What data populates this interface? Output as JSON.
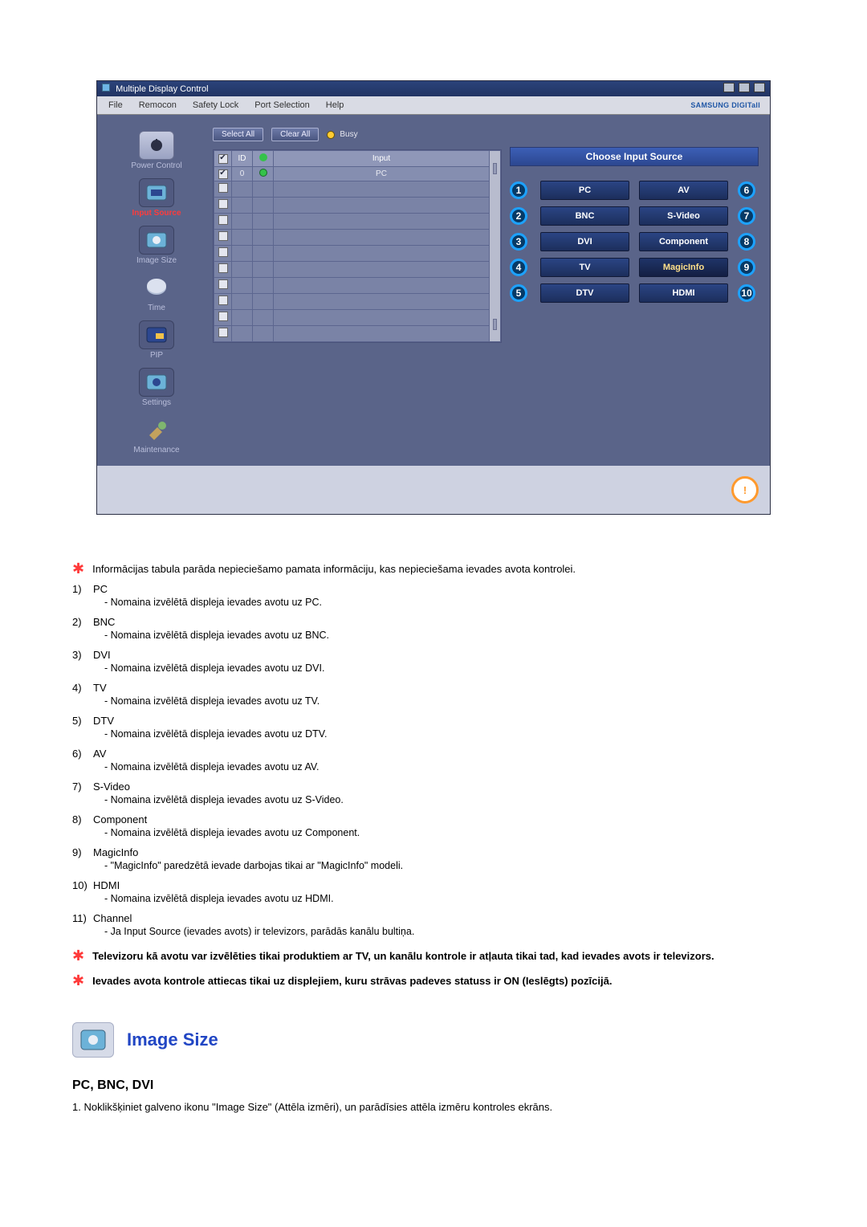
{
  "app": {
    "title": "Multiple Display Control",
    "brand": "SAMSUNG DIGITall",
    "menu": [
      "File",
      "Remocon",
      "Safety Lock",
      "Port Selection",
      "Help"
    ],
    "buttons": {
      "select_all": "Select All",
      "clear_all": "Clear All",
      "busy": "Busy"
    },
    "sidebar": {
      "items": [
        {
          "id": "power-control",
          "label": "Power Control"
        },
        {
          "id": "input-source",
          "label": "Input Source"
        },
        {
          "id": "image-size",
          "label": "Image Size"
        },
        {
          "id": "time",
          "label": "Time"
        },
        {
          "id": "pip",
          "label": "PIP"
        },
        {
          "id": "settings",
          "label": "Settings"
        },
        {
          "id": "maintenance",
          "label": "Maintenance"
        }
      ],
      "active": "input-source"
    },
    "grid": {
      "headers": {
        "check": "",
        "id": "ID",
        "power": "",
        "input": "Input"
      },
      "rows": [
        {
          "checked": true,
          "id": "0",
          "power": "on",
          "input": "PC"
        }
      ],
      "empty_rows": 10
    },
    "source_panel": {
      "title": "Choose Input Source",
      "left": [
        {
          "n": "1",
          "label": "PC"
        },
        {
          "n": "2",
          "label": "BNC"
        },
        {
          "n": "3",
          "label": "DVI"
        },
        {
          "n": "4",
          "label": "TV"
        },
        {
          "n": "5",
          "label": "DTV"
        }
      ],
      "right": [
        {
          "n": "6",
          "label": "AV"
        },
        {
          "n": "7",
          "label": "S-Video"
        },
        {
          "n": "8",
          "label": "Component"
        },
        {
          "n": "9",
          "label": "MagicInfo",
          "magic": true
        },
        {
          "n": "10",
          "label": "HDMI"
        }
      ]
    }
  },
  "doc": {
    "intro_note": "Informācijas tabula parāda nepieciešamo pamata informāciju, kas nepieciešama ievades avota kontrolei.",
    "items": [
      {
        "n": "1)",
        "title": "PC",
        "sub": "- Nomaina izvēlētā displeja ievades avotu uz PC."
      },
      {
        "n": "2)",
        "title": "BNC",
        "sub": "- Nomaina izvēlētā displeja ievades avotu uz BNC."
      },
      {
        "n": "3)",
        "title": "DVI",
        "sub": "- Nomaina izvēlētā displeja ievades avotu uz DVI."
      },
      {
        "n": "4)",
        "title": "TV",
        "sub": "- Nomaina izvēlētā displeja ievades avotu uz TV."
      },
      {
        "n": "5)",
        "title": "DTV",
        "sub": "- Nomaina izvēlētā displeja ievades avotu uz DTV."
      },
      {
        "n": "6)",
        "title": "AV",
        "sub": "- Nomaina izvēlētā displeja ievades avotu uz AV."
      },
      {
        "n": "7)",
        "title": "S-Video",
        "sub": "- Nomaina izvēlētā displeja ievades avotu uz S-Video."
      },
      {
        "n": "8)",
        "title": "Component",
        "sub": "- Nomaina izvēlētā displeja ievades avotu uz Component."
      },
      {
        "n": "9)",
        "title": "MagicInfo",
        "sub": "- \"MagicInfo\" paredzētā ievade darbojas tikai ar \"MagicInfo\" modeli."
      },
      {
        "n": "10)",
        "title": "HDMI",
        "sub": "- Nomaina izvēlētā displeja ievades avotu uz HDMI."
      },
      {
        "n": "11)",
        "title": "Channel",
        "sub": "- Ja Input Source (ievades avots) ir televizors, parādās kanālu bultiņa."
      }
    ],
    "note_tv": "Televizoru kā avotu var izvēlēties tikai produktiem ar TV, un kanālu kontrole ir atļauta tikai tad, kad ievades avots ir televizors.",
    "note_on": "Ievades avota kontrole attiecas tikai uz displejiem, kuru strāvas padeves statuss ir ON (Ieslēgts) pozīcijā.",
    "section_title": "Image Size",
    "sub_head": "PC, BNC, DVI",
    "sub_para": "1. Noklikšķiniet galveno ikonu \"Image Size\" (Attēla izmēri), un parādīsies attēla izmēru kontroles ekrāns."
  }
}
